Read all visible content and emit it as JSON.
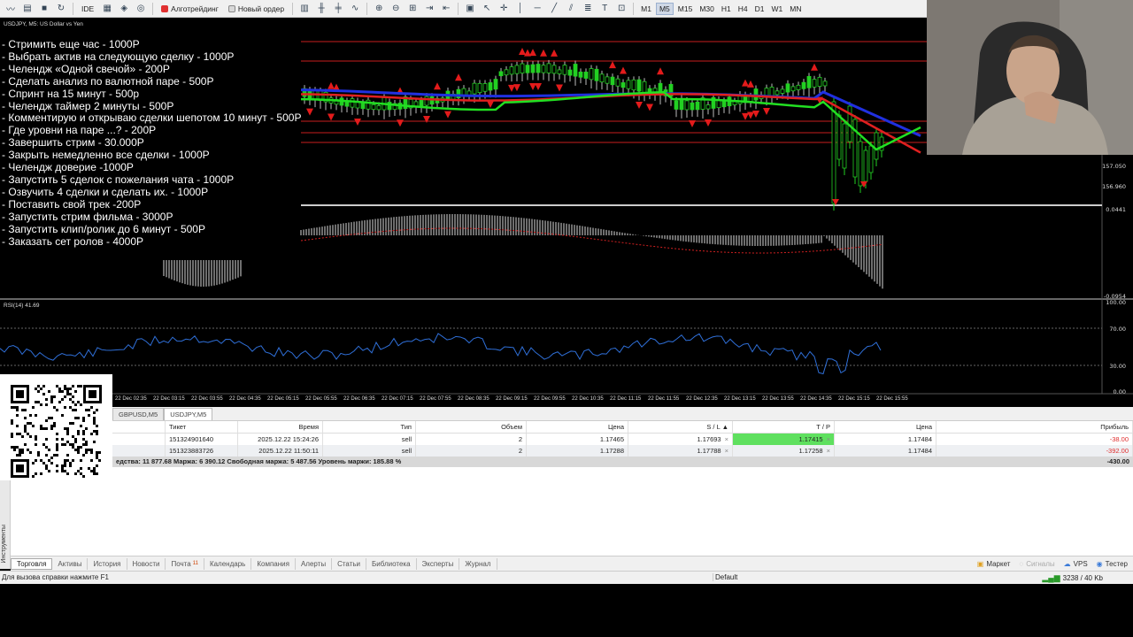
{
  "toolbar": {
    "algo_label": "Алготрейдинг",
    "new_order_label": "Новый ордер",
    "timeframes": [
      "M1",
      "M5",
      "M15",
      "M30",
      "H1",
      "H4",
      "D1",
      "W1",
      "MN"
    ],
    "active_timeframe": "M5",
    "ide_label": "IDE"
  },
  "chart": {
    "title": "USDJPY, M5:  US Dollar vs Yen",
    "price_labels": [
      "157.050",
      "156.960",
      "0.0441",
      "-0.0954",
      "100.00",
      "70.00",
      "30.00",
      "0.00"
    ],
    "rsi_title": "RSI(14) 41.69",
    "time_labels": [
      "22 Dec 02:35",
      "22 Dec 03:15",
      "22 Dec 03:55",
      "22 Dec 04:35",
      "22 Dec 05:15",
      "22 Dec 05:55",
      "22 Dec 06:35",
      "22 Dec 07:15",
      "22 Dec 07:55",
      "22 Dec 08:35",
      "22 Dec 09:15",
      "22 Dec 09:55",
      "22 Dec 10:35",
      "22 Dec 11:15",
      "22 Dec 11:55",
      "22 Dec 12:35",
      "22 Dec 13:15",
      "22 Dec 13:55",
      "22 Dec 14:35",
      "22 Dec 15:15",
      "22 Dec 15:55"
    ]
  },
  "donations": [
    "- Стримить еще час - 1000Р",
    "- Выбрать актив на следующую сделку - 1000Р",
    "- Челендж «Одной свечой» - 200Р",
    "- Сделать анализ по валютной паре - 500Р",
    "- Спринт на 15 минут - 500р",
    "- Челендж таймер 2 минуты - 500Р",
    "- Комментирую и открываю сделки шепотом 10 минут - 500Р",
    "- Где уровни на паре ...?  - 200Р",
    "- Завершить стрим - 30.000Р",
    "- Закрыть немедленно все сделки - 1000Р",
    "- Челендж доверие -1000Р",
    "- Запустить 5 сделок с пожелания чата - 1000Р",
    "- Озвучить 4 сделки и сделать их. - 1000Р",
    "- Поставить свой трек -200Р",
    "- Запустить стрим фильма - 3000Р",
    "- Запустить клип/ролик до 6 минут - 500Р",
    "- Заказать сет ролов - 4000Р"
  ],
  "trade": {
    "symbol_tabs": [
      "GBPUSD,M5",
      "USDJPY,M5"
    ],
    "active_symbol_tab": "USDJPY,M5",
    "headers": [
      "",
      "Тикет",
      "Время",
      "Тип",
      "Объем",
      "Цена",
      "S / L",
      "T / P",
      "Цена",
      "Прибыль"
    ],
    "rows": [
      {
        "ticket": "151324901640",
        "time": "2025.12.22 15:24:26",
        "type": "sell",
        "volume": "2",
        "price": "1.17465",
        "sl": "1.17693",
        "tp": "1.17415",
        "cur_price": "1.17484",
        "profit": "-38.00"
      },
      {
        "ticket": "151323883726",
        "time": "2025.12.22 11:50:11",
        "type": "sell",
        "volume": "2",
        "price": "1.17288",
        "sl": "1.17788",
        "tp": "1.17258",
        "cur_price": "1.17484",
        "profit": "-392.00"
      }
    ],
    "balance_text": "едства: 11 877.68  Маржа: 6 390.12  Свободная маржа: 5 487.56  Уровень маржи: 185.88 %",
    "total_profit": "-430.00"
  },
  "side_strip_label": "Инструменты",
  "bottom_tabs": [
    {
      "label": "Торговля",
      "active": true
    },
    {
      "label": "Активы"
    },
    {
      "label": "История"
    },
    {
      "label": "Новости"
    },
    {
      "label": "Почта",
      "badge": "11"
    },
    {
      "label": "Календарь"
    },
    {
      "label": "Компания"
    },
    {
      "label": "Алерты"
    },
    {
      "label": "Статьи"
    },
    {
      "label": "Библиотека"
    },
    {
      "label": "Эксперты"
    },
    {
      "label": "Журнал"
    }
  ],
  "right_tabs": [
    {
      "label": "Маркет",
      "icon": "basket-icon"
    },
    {
      "label": "Сигналы",
      "icon": "signal-icon",
      "dim": true
    },
    {
      "label": "VPS",
      "icon": "cloud-icon"
    },
    {
      "label": "Тестер",
      "icon": "tester-icon"
    }
  ],
  "status": {
    "help": "Для вызова справки нажмите F1",
    "profile": "Default",
    "traffic": "3238 / 40 Kb"
  },
  "colors": {
    "up_arrow": "#e31b1b",
    "ma_fast": "#22e022",
    "ma_mid": "#e02020",
    "ma_slow": "#2030e0",
    "rsi_line": "#2f6fd8",
    "tp_highlight": "#5fe05f",
    "loss": "#e03030"
  }
}
